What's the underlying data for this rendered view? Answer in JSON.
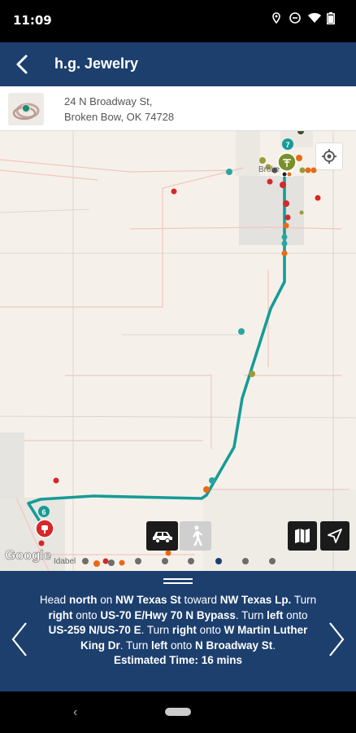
{
  "status": {
    "time": "11:09"
  },
  "header": {
    "title": "h.g. Jewelry"
  },
  "store": {
    "address_line1": "24 N Broadway St,",
    "address_line2": "Broken Bow, OK 74728"
  },
  "map": {
    "labels": {
      "town_top": "Broke",
      "town_bottom": "Idabel",
      "marker_top": "7",
      "marker_bottom": "6"
    },
    "google": "Google"
  },
  "directions": {
    "p1": "Head ",
    "s1": "north",
    "p2": " on ",
    "s2": "NW Texas St",
    "p3": " toward ",
    "s3": "NW Texas Lp.",
    "p4": " Turn ",
    "s4": "right",
    "p5": " onto ",
    "s5": "US-70 E/Hwy 70 N Bypass",
    "p6": ". Turn ",
    "s6": "left",
    "p7": " onto ",
    "s7": "US-259 N/US-70 E",
    "p8": ". Turn ",
    "s8": "right",
    "p9": " onto ",
    "s9": "W Martin Luther King Dr",
    "p10": ". Turn ",
    "s10": "left",
    "p11": " onto ",
    "s11": "N Broadway St",
    "p12": ".",
    "estimate": "Estimated Time: 16 mins"
  },
  "colors": {
    "header_bg": "#1c3f6e",
    "route": "#179b97",
    "map_bg": "#f5f1ea"
  },
  "icons": [
    "back-arrow-icon",
    "location-icon",
    "minus-circle-icon",
    "wifi-icon",
    "battery-icon",
    "my-location-icon",
    "car-icon",
    "walk-icon",
    "map-icon",
    "navigation-icon",
    "chevron-left-icon",
    "chevron-right-icon"
  ]
}
